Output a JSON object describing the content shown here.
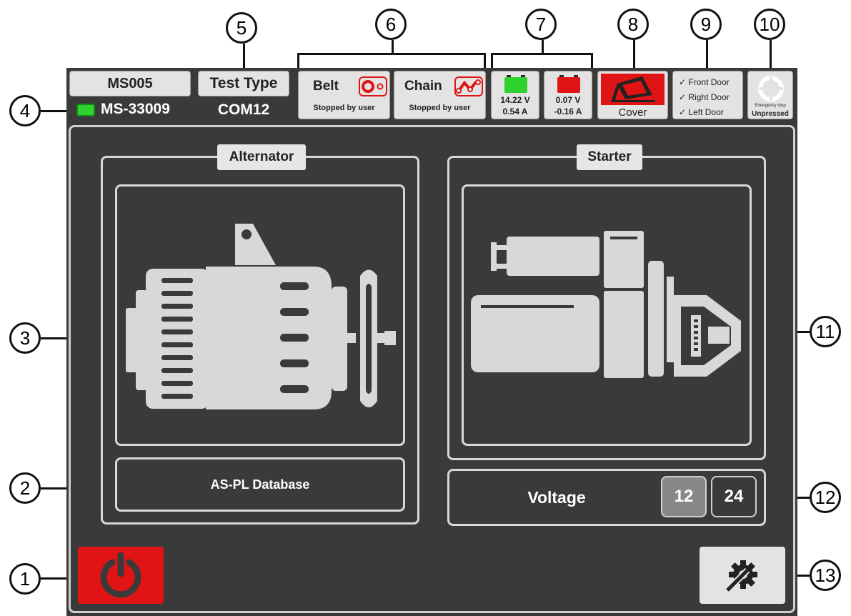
{
  "header": {
    "device_name": "MS005",
    "serial": "MS-33009",
    "test_type_label": "Test Type",
    "port": "COM12"
  },
  "drives": {
    "belt": {
      "label": "Belt",
      "status": "Stopped by user"
    },
    "chain": {
      "label": "Chain",
      "status": "Stopped by user"
    }
  },
  "batteries": [
    {
      "voltage": "14.22 V",
      "current": "0.54 A",
      "color": "#2ed12e"
    },
    {
      "voltage": "0.07 V",
      "current": "-0.16 A",
      "color": "#e01414"
    }
  ],
  "cover": {
    "label": "Cover",
    "color": "#e01414"
  },
  "doors": [
    "Front Door",
    "Right Door",
    "Left Door"
  ],
  "doors_check": "✓",
  "emergency": {
    "line1": "Emergency stop",
    "line2": "Unpressed"
  },
  "alternator": {
    "title": "Alternator",
    "database": "AS-PL Database"
  },
  "starter": {
    "title": "Starter"
  },
  "voltage": {
    "label": "Voltage",
    "options": [
      "12",
      "24"
    ],
    "selected": "12"
  },
  "callouts": [
    "1",
    "2",
    "3",
    "4",
    "5",
    "6",
    "7",
    "8",
    "9",
    "10",
    "11",
    "12",
    "13"
  ],
  "colors": {
    "background": "#3a3a3a",
    "accent_red": "#e01414",
    "status_green": "#2ed12e"
  }
}
